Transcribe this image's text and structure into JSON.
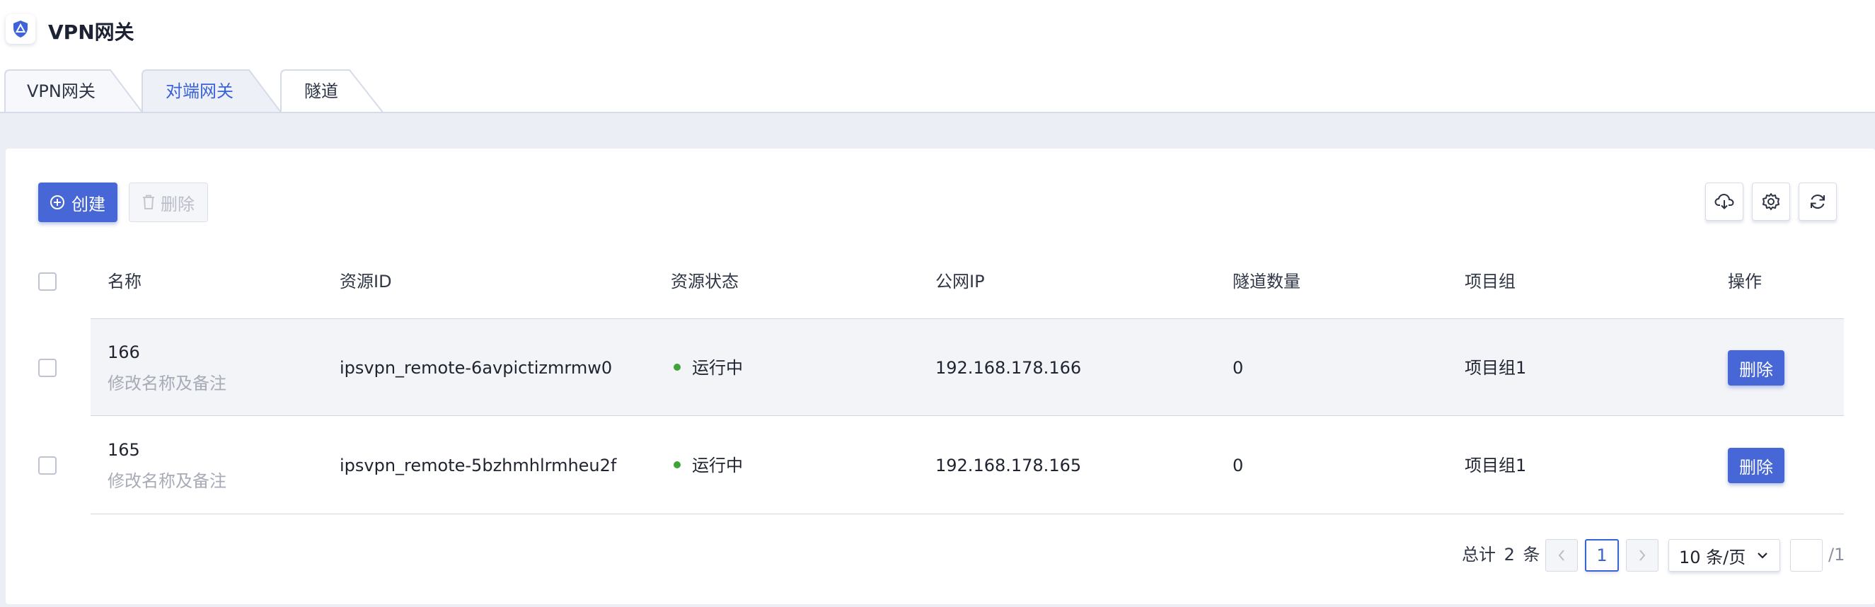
{
  "app": {
    "title": "VPN网关"
  },
  "tabs": [
    {
      "label": "VPN网关",
      "active": false
    },
    {
      "label": "对端网关",
      "active": true
    },
    {
      "label": "隧道",
      "active": false
    }
  ],
  "toolbar": {
    "create_label": "创建",
    "delete_label": "删除",
    "icons": [
      "cloud-download-icon",
      "gear-icon",
      "refresh-icon"
    ]
  },
  "table": {
    "columns": [
      "名称",
      "资源ID",
      "资源状态",
      "公网IP",
      "隧道数量",
      "项目组",
      "操作"
    ],
    "rows": [
      {
        "name": "166",
        "note": "修改名称及备注",
        "resource_id": "ipsvpn_remote-6avpictizmrmw0",
        "status": "运行中",
        "public_ip": "192.168.178.166",
        "tunnel_count": "0",
        "project_group": "项目组1",
        "action": "删除"
      },
      {
        "name": "165",
        "note": "修改名称及备注",
        "resource_id": "ipsvpn_remote-5bzhmhlrmheu2f",
        "status": "运行中",
        "public_ip": "192.168.178.165",
        "tunnel_count": "0",
        "project_group": "项目组1",
        "action": "删除"
      }
    ]
  },
  "pagination": {
    "total_text": "总计 2 条",
    "current_page": "1",
    "page_size": "10 条/页",
    "total_pages": "/1"
  },
  "colors": {
    "primary": "#4767d6",
    "active_tab": "#3a62d7",
    "status_running": "#3fa33a",
    "content_bg": "#eceef6"
  }
}
